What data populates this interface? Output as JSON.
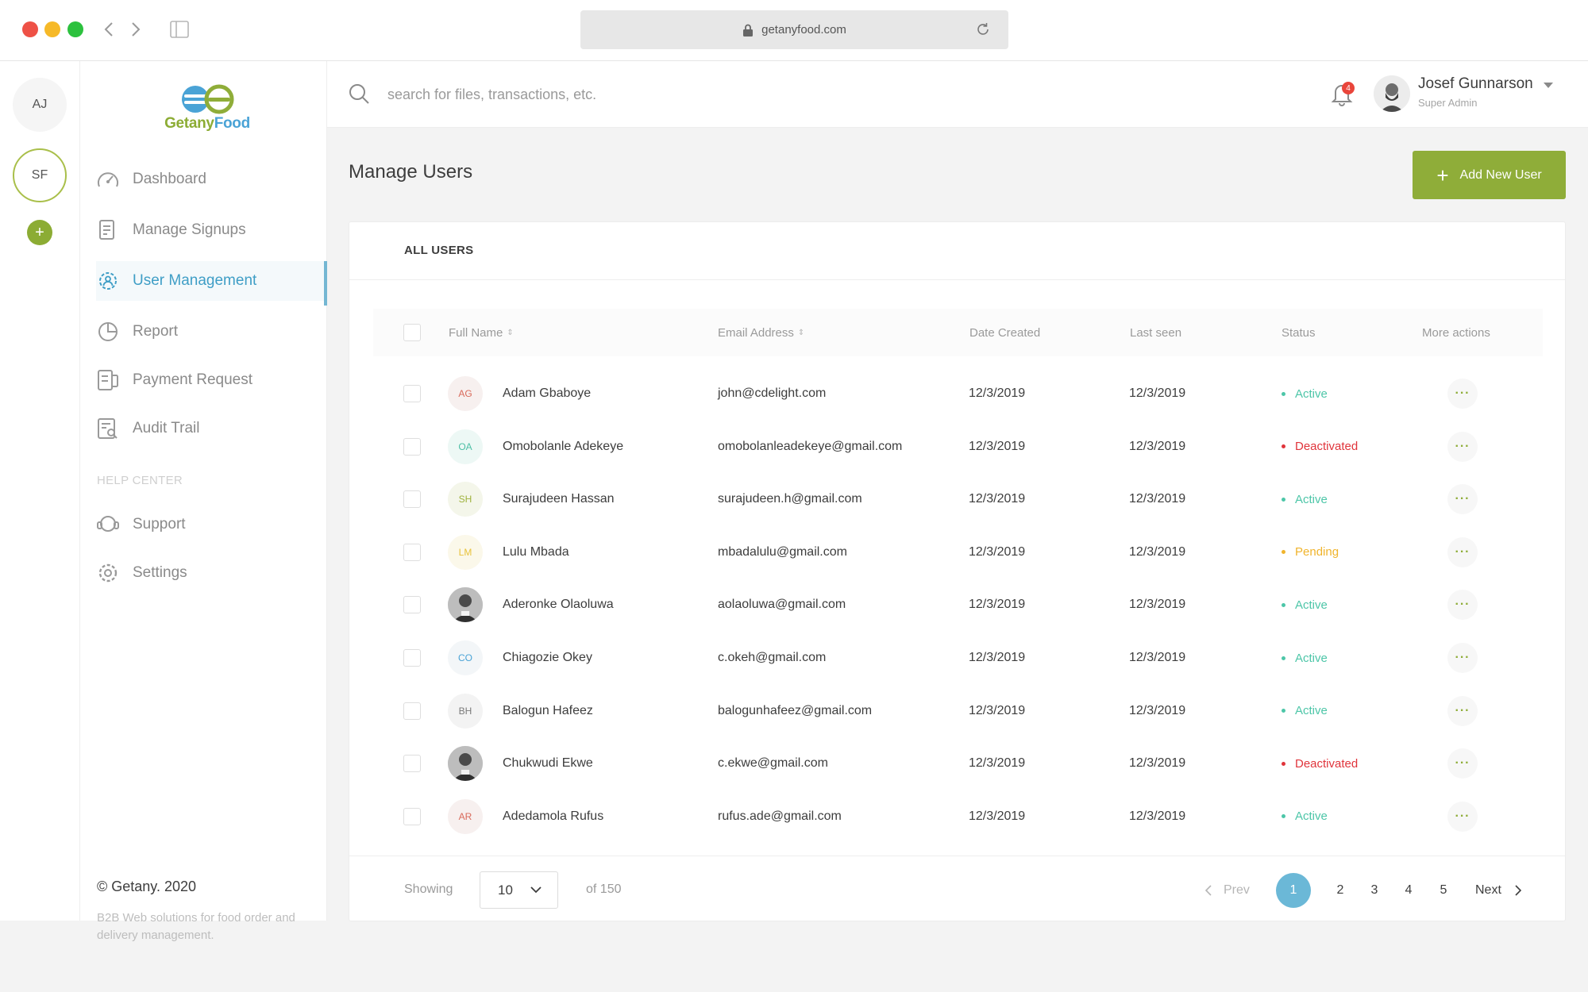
{
  "browser": {
    "url": "getanyfood.com"
  },
  "workspaces": [
    {
      "initials": "AJ"
    },
    {
      "initials": "SF"
    }
  ],
  "workspace_add_label": "+",
  "brand": {
    "name_part1": "Getany",
    "name_part2": "Food",
    "accent_color": "#8fad39",
    "secondary_color": "#4aa3d6"
  },
  "sidebar": {
    "items": [
      {
        "label": "Dashboard",
        "icon": "gauge-icon"
      },
      {
        "label": "Manage Signups",
        "icon": "document-edit-icon"
      },
      {
        "label": "User Management",
        "icon": "user-gear-icon",
        "active": true
      },
      {
        "label": "Report",
        "icon": "pie-chart-icon"
      },
      {
        "label": "Payment Request",
        "icon": "receipt-icon"
      },
      {
        "label": "Audit Trail",
        "icon": "audit-list-icon"
      }
    ],
    "help_title": "HELP CENTER",
    "help_items": [
      {
        "label": "Support",
        "icon": "headset-icon"
      },
      {
        "label": "Settings",
        "icon": "gear-icon"
      }
    ],
    "copyright": "© Getany. 2020",
    "tagline": "B2B Web solutions for food order and delivery management."
  },
  "topbar": {
    "search_placeholder": "search for files, transactions, etc.",
    "notification_count": "4",
    "user_name": "Josef Gunnarson",
    "user_role": "Super Admin"
  },
  "page": {
    "title": "Manage Users",
    "add_button_label": "Add New User",
    "tab_label": "ALL USERS"
  },
  "table": {
    "headers": {
      "name": "Full Name",
      "email": "Email Address",
      "created": "Date Created",
      "last_seen": "Last seen",
      "status": "Status",
      "actions": "More actions"
    },
    "more_label": "···",
    "rows": [
      {
        "initials": "AG",
        "initials_color": "#d96a5b",
        "initials_bg": "#f7f0ef",
        "name": "Adam Gbaboye",
        "email": "john@cdelight.com",
        "created": "12/3/2019",
        "last_seen": "12/3/2019",
        "status": "Active",
        "status_color": "#4dc6a8"
      },
      {
        "initials": "OA",
        "initials_color": "#4dbfa5",
        "initials_bg": "#edf8f5",
        "name": "Omobolanle Adekeye",
        "email": "omobolanleadekeye@gmail.com",
        "created": "12/3/2019",
        "last_seen": "12/3/2019",
        "status": "Deactivated",
        "status_color": "#e0343b"
      },
      {
        "initials": "SH",
        "initials_color": "#9fb23c",
        "initials_bg": "#f4f6ea",
        "name": "Surajudeen Hassan",
        "email": "surajudeen.h@gmail.com",
        "created": "12/3/2019",
        "last_seen": "12/3/2019",
        "status": "Active",
        "status_color": "#4dc6a8"
      },
      {
        "initials": "LM",
        "initials_color": "#e8c33c",
        "initials_bg": "#fbf8ea",
        "name": "Lulu Mbada",
        "email": "mbadalulu@gmail.com",
        "created": "12/3/2019",
        "last_seen": "12/3/2019",
        "status": "Pending",
        "status_color": "#f0b42c"
      },
      {
        "photo": true,
        "name": "Aderonke Olaoluwa",
        "email": "aolaoluwa@gmail.com",
        "created": "12/3/2019",
        "last_seen": "12/3/2019",
        "status": "Active",
        "status_color": "#4dc6a8"
      },
      {
        "initials": "CO",
        "initials_color": "#4aa3d6",
        "initials_bg": "#f3f6f8",
        "name": "Chiagozie Okey",
        "email": "c.okeh@gmail.com",
        "created": "12/3/2019",
        "last_seen": "12/3/2019",
        "status": "Active",
        "status_color": "#4dc6a8"
      },
      {
        "initials": "BH",
        "initials_color": "#7a7a7a",
        "initials_bg": "#f3f3f3",
        "name": "Balogun Hafeez",
        "email": "balogunhafeez@gmail.com",
        "created": "12/3/2019",
        "last_seen": "12/3/2019",
        "status": "Active",
        "status_color": "#4dc6a8"
      },
      {
        "photo": true,
        "name": "Chukwudi Ekwe",
        "email": "c.ekwe@gmail.com",
        "created": "12/3/2019",
        "last_seen": "12/3/2019",
        "status": "Deactivated",
        "status_color": "#e0343b"
      },
      {
        "initials": "AR",
        "initials_color": "#d96a5b",
        "initials_bg": "#f7f0ef",
        "name": "Adedamola Rufus",
        "email": "rufus.ade@gmail.com",
        "created": "12/3/2019",
        "last_seen": "12/3/2019",
        "status": "Active",
        "status_color": "#4dc6a8"
      }
    ]
  },
  "pagination": {
    "showing_label": "Showing",
    "page_size": "10",
    "total_label": "of 150",
    "prev_label": "Prev",
    "next_label": "Next",
    "pages": [
      "1",
      "2",
      "3",
      "4",
      "5"
    ],
    "current_page": "1"
  }
}
